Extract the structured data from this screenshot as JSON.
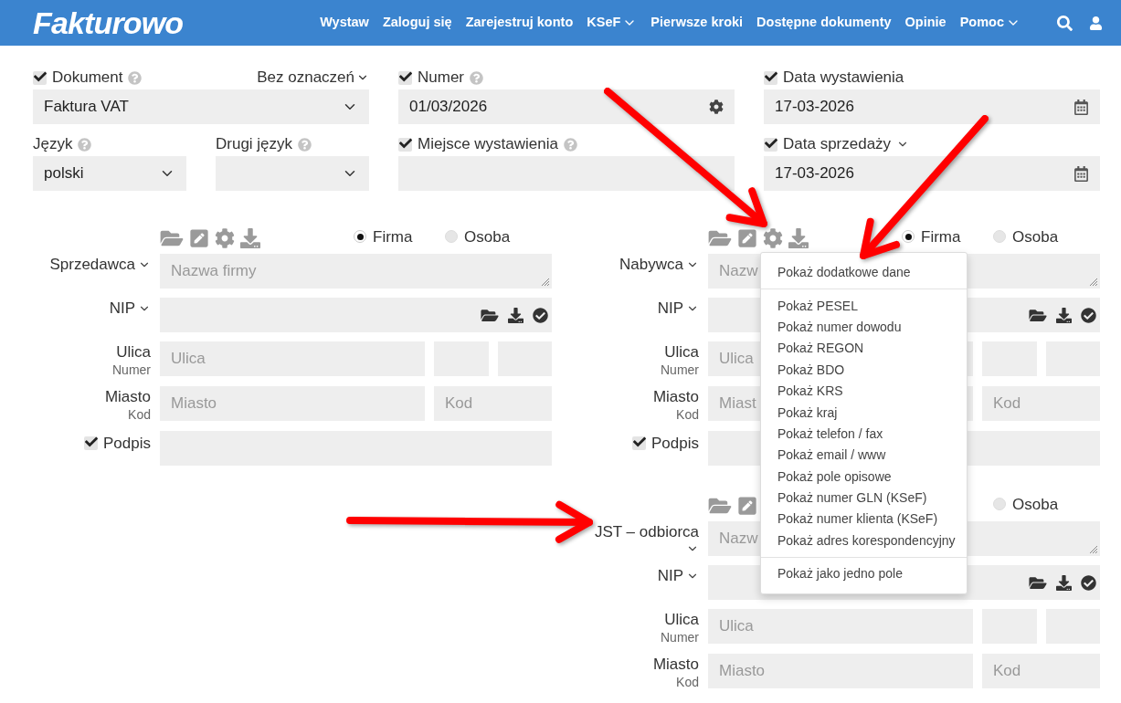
{
  "header": {
    "logo": "Fakturowo",
    "nav": [
      {
        "label": "Wystaw",
        "menu": false
      },
      {
        "label": "Zaloguj się",
        "menu": false
      },
      {
        "label": "Zarejestruj konto",
        "menu": false
      },
      {
        "label": "KSeF",
        "menu": true
      },
      {
        "label": "Pierwsze kroki",
        "menu": false
      },
      {
        "label": "Dostępne dokumenty",
        "menu": false
      },
      {
        "label": "Opinie",
        "menu": false
      },
      {
        "label": "Pomoc",
        "menu": true
      }
    ]
  },
  "top_form": {
    "rows": [
      [
        {
          "kind": "select",
          "label": "Dokument",
          "checked": true,
          "help": true,
          "option": "Bez oznaczeń",
          "value": "Faktura VAT"
        },
        {
          "kind": "number",
          "label": "Numer",
          "checked": true,
          "help": true,
          "value": "01/03/2026"
        },
        {
          "kind": "date",
          "label": "Data wystawienia",
          "checked": true,
          "help": false,
          "value": "17-03-2026"
        }
      ],
      [
        {
          "kind": "pair",
          "fields": [
            {
              "kind": "select",
              "label": "Język",
              "help": true,
              "value": "polski"
            },
            {
              "kind": "select",
              "label": "Drugi język",
              "help": true
            }
          ]
        },
        {
          "kind": "text",
          "label": "Miejsce wystawienia",
          "checked": true,
          "help": true
        },
        {
          "kind": "date",
          "label": "Data sprzedaży",
          "checked": true,
          "help": false,
          "label_menu": true,
          "value": "17-03-2026"
        }
      ]
    ]
  },
  "parties": {
    "left": [
      {
        "covered": false,
        "types": [
          {
            "label": "Firma",
            "selected": true
          },
          {
            "label": "Osoba",
            "selected": false
          }
        ],
        "rows": [
          {
            "kind": "name",
            "label": "Sprzedawca",
            "label_menu": true,
            "placeholder": "Nazwa firmy"
          },
          {
            "kind": "nip",
            "label": "NIP",
            "label_menu": true
          },
          {
            "kind": "street",
            "label": "Ulica",
            "sublabel": "Numer",
            "placeholder": "Ulica"
          },
          {
            "kind": "city",
            "label": "Miasto",
            "sublabel": "Kod",
            "placeholder": "Miasto",
            "code_placeholder": "Kod"
          },
          {
            "kind": "signature",
            "label": "Podpis",
            "checked": true
          }
        ]
      }
    ],
    "right": [
      {
        "covered": false,
        "types": [
          {
            "label": "Firma",
            "selected": true
          },
          {
            "label": "Osoba",
            "selected": false
          }
        ],
        "rows": [
          {
            "kind": "name",
            "label": "Nabywca",
            "label_menu": true,
            "placeholder": "Nazw"
          },
          {
            "kind": "nip",
            "label": "NIP",
            "label_menu": true
          },
          {
            "kind": "street",
            "label": "Ulica",
            "sublabel": "Numer",
            "placeholder": "Ulica"
          },
          {
            "kind": "city",
            "label": "Miasto",
            "sublabel": "Kod",
            "placeholder": "Miast",
            "code_placeholder": "Kod"
          },
          {
            "kind": "signature",
            "label": "Podpis",
            "checked": true
          }
        ]
      },
      {
        "covered": true,
        "types": [
          {
            "label": "Osoba",
            "selected": false
          }
        ],
        "rows": [
          {
            "kind": "name",
            "label": "JST – odbiorca",
            "label_menu": true,
            "menu_below": true,
            "placeholder": "Nazw"
          },
          {
            "kind": "nip",
            "label": "NIP",
            "label_menu": true
          },
          {
            "kind": "street",
            "label": "Ulica",
            "sublabel": "Numer",
            "placeholder": "Ulica"
          },
          {
            "kind": "city",
            "label": "Miasto",
            "sublabel": "Kod",
            "placeholder": "Miasto",
            "code_placeholder": "Kod"
          }
        ]
      }
    ]
  },
  "menu": {
    "sections": [
      [
        "Pokaż dodatkowe dane"
      ],
      [
        "Pokaż PESEL",
        "Pokaż numer dowodu",
        "Pokaż REGON",
        "Pokaż BDO",
        "Pokaż KRS",
        "Pokaż kraj",
        "Pokaż telefon / fax",
        "Pokaż email / www",
        "Pokaż pole opisowe",
        "Pokaż numer GLN (KSeF)",
        "Pokaż numer klienta (KSeF)",
        "Pokaż adres korespondencyjny"
      ],
      [
        "Pokaż jako jedno pole"
      ]
    ]
  }
}
